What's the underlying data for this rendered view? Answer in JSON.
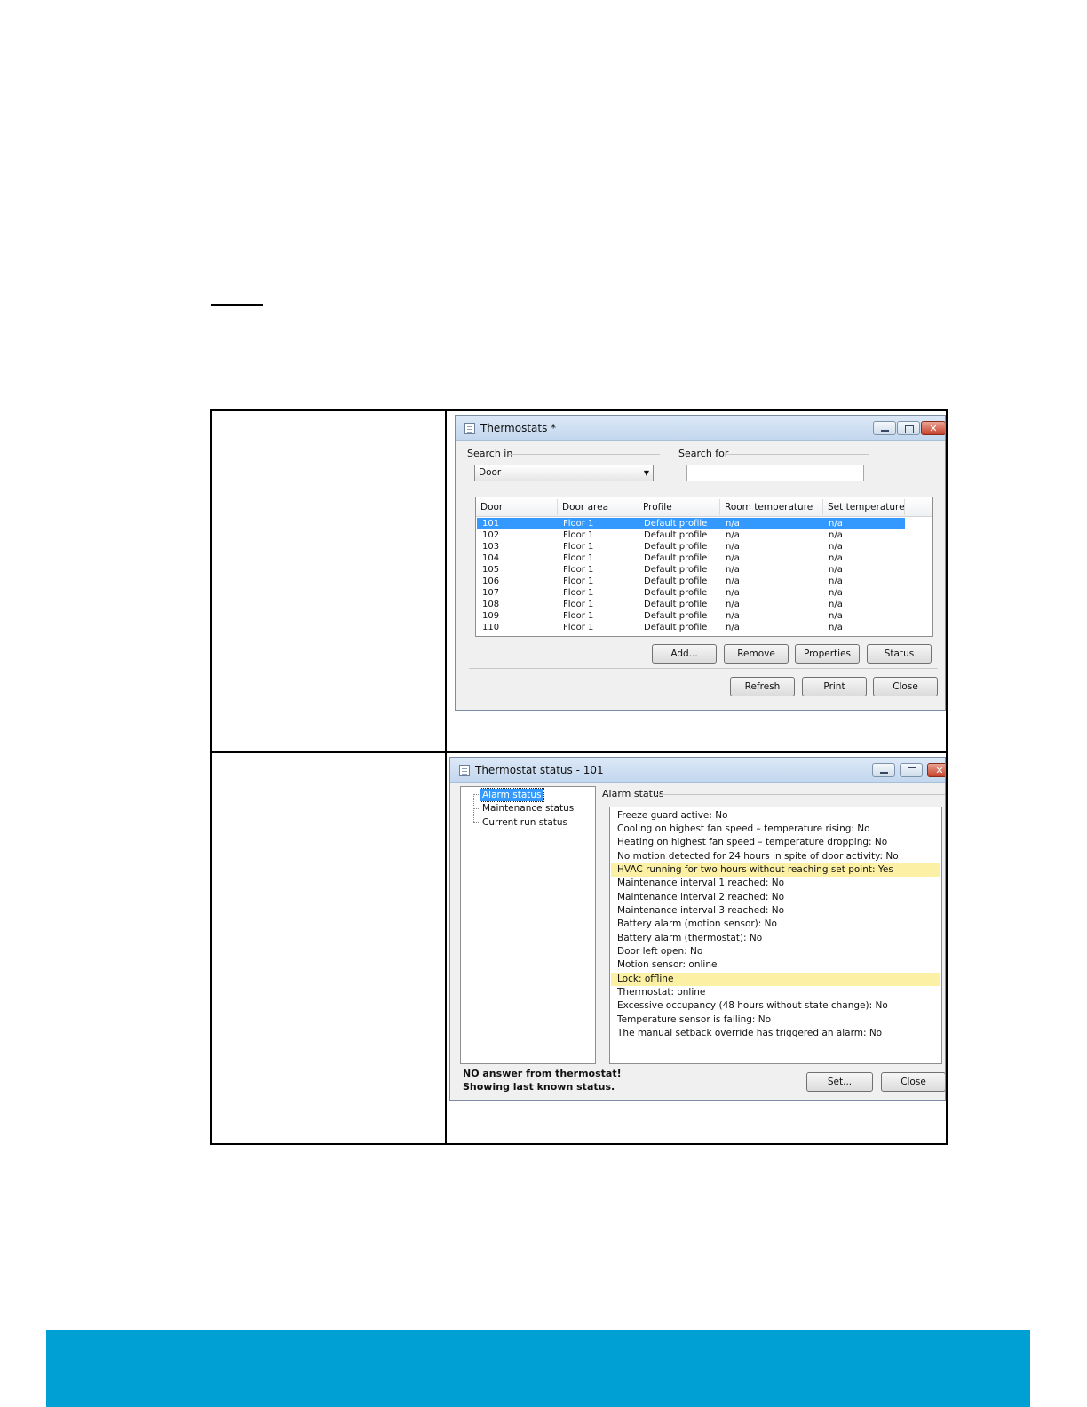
{
  "thermostats_window": {
    "title": "Thermostats *",
    "search_in_label": "Search in",
    "search_in_value": "Door",
    "search_for_label": "Search for",
    "search_for_value": "",
    "columns": [
      "Door",
      "Door area",
      "Profile",
      "Room temperature",
      "Set temperature"
    ],
    "rows": [
      {
        "door": "101",
        "area": "Floor 1",
        "profile": "Default profile",
        "room_temp": "n/a",
        "set_temp": "n/a",
        "selected": true
      },
      {
        "door": "102",
        "area": "Floor 1",
        "profile": "Default profile",
        "room_temp": "n/a",
        "set_temp": "n/a"
      },
      {
        "door": "103",
        "area": "Floor 1",
        "profile": "Default profile",
        "room_temp": "n/a",
        "set_temp": "n/a"
      },
      {
        "door": "104",
        "area": "Floor 1",
        "profile": "Default profile",
        "room_temp": "n/a",
        "set_temp": "n/a"
      },
      {
        "door": "105",
        "area": "Floor 1",
        "profile": "Default profile",
        "room_temp": "n/a",
        "set_temp": "n/a"
      },
      {
        "door": "106",
        "area": "Floor 1",
        "profile": "Default profile",
        "room_temp": "n/a",
        "set_temp": "n/a"
      },
      {
        "door": "107",
        "area": "Floor 1",
        "profile": "Default profile",
        "room_temp": "n/a",
        "set_temp": "n/a"
      },
      {
        "door": "108",
        "area": "Floor 1",
        "profile": "Default profile",
        "room_temp": "n/a",
        "set_temp": "n/a"
      },
      {
        "door": "109",
        "area": "Floor 1",
        "profile": "Default profile",
        "room_temp": "n/a",
        "set_temp": "n/a"
      },
      {
        "door": "110",
        "area": "Floor 1",
        "profile": "Default profile",
        "room_temp": "n/a",
        "set_temp": "n/a"
      }
    ],
    "buttons": {
      "add": "Add...",
      "remove": "Remove",
      "properties": "Properties",
      "status": "Status",
      "refresh": "Refresh",
      "print": "Print",
      "close": "Close"
    }
  },
  "status_window": {
    "title": "Thermostat status - 101",
    "tree": [
      "Alarm status",
      "Maintenance status",
      "Current run status"
    ],
    "selected_tree_item": "Alarm status",
    "group_label": "Alarm status",
    "status_lines": [
      {
        "text": "Freeze guard active: No"
      },
      {
        "text": "Cooling on highest fan speed – temperature rising: No"
      },
      {
        "text": "Heating on highest fan speed – temperature dropping: No"
      },
      {
        "text": "No motion detected for 24 hours in spite of door activity: No"
      },
      {
        "text": "HVAC running for two hours without reaching set point: Yes",
        "highlight": true
      },
      {
        "text": "Maintenance interval 1 reached: No"
      },
      {
        "text": "Maintenance interval 2 reached: No"
      },
      {
        "text": "Maintenance interval 3 reached: No"
      },
      {
        "text": "Battery alarm (motion sensor): No"
      },
      {
        "text": "Battery alarm (thermostat): No"
      },
      {
        "text": "Door left open: No"
      },
      {
        "text": "Motion sensor: online"
      },
      {
        "text": "Lock: offline",
        "highlight": true
      },
      {
        "text": "Thermostat: online"
      },
      {
        "text": "Excessive occupancy (48 hours without state change): No"
      },
      {
        "text": "Temperature sensor is failing: No"
      },
      {
        "text": "The manual setback override has triggered an alarm: No"
      }
    ],
    "warning_line1": "NO answer from thermostat!",
    "warning_line2": "Showing last known status.",
    "buttons": {
      "set": "Set...",
      "close": "Close"
    }
  },
  "colors": {
    "selection": "#3399ff",
    "highlight": "#fbf0a3",
    "footer_band": "#009fd4"
  }
}
